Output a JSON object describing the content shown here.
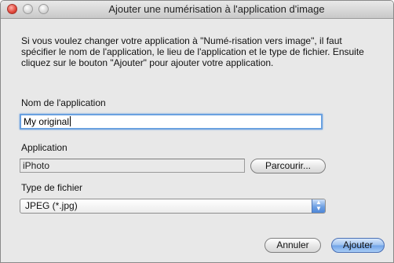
{
  "window": {
    "title": "Ajouter une numérisation à l'application d'image"
  },
  "description": "Si vous voulez changer votre application à \"Numé-risation vers image\", il faut spécifier le nom de l'application, le lieu de l'application et le type de fichier. Ensuite cliquez sur le bouton \"Ajouter\" pour ajouter votre application.",
  "app_name": {
    "label": "Nom de l'application",
    "value": "My original"
  },
  "application": {
    "label": "Application",
    "value": "iPhoto",
    "browse_label": "Parcourir..."
  },
  "file_type": {
    "label": "Type de fichier",
    "selected": "JPEG (*.jpg)"
  },
  "buttons": {
    "cancel": "Annuler",
    "add": "Ajouter"
  }
}
